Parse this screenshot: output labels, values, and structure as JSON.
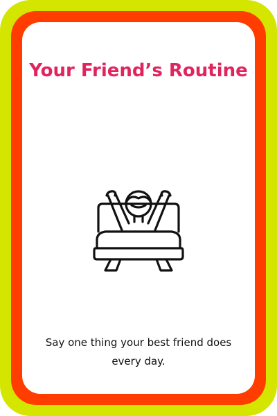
{
  "card": {
    "title": "Your Friend’s Routine",
    "caption": "Say one thing your best friend does every day.",
    "illustration_icon": "person-waking-up-in-bed-icon",
    "colors": {
      "outer_border": "#d4e600",
      "inner_border": "#ff3d00",
      "panel": "#ffffff",
      "title": "#e0245e",
      "caption": "#111111",
      "icon_stroke": "#111111"
    }
  }
}
